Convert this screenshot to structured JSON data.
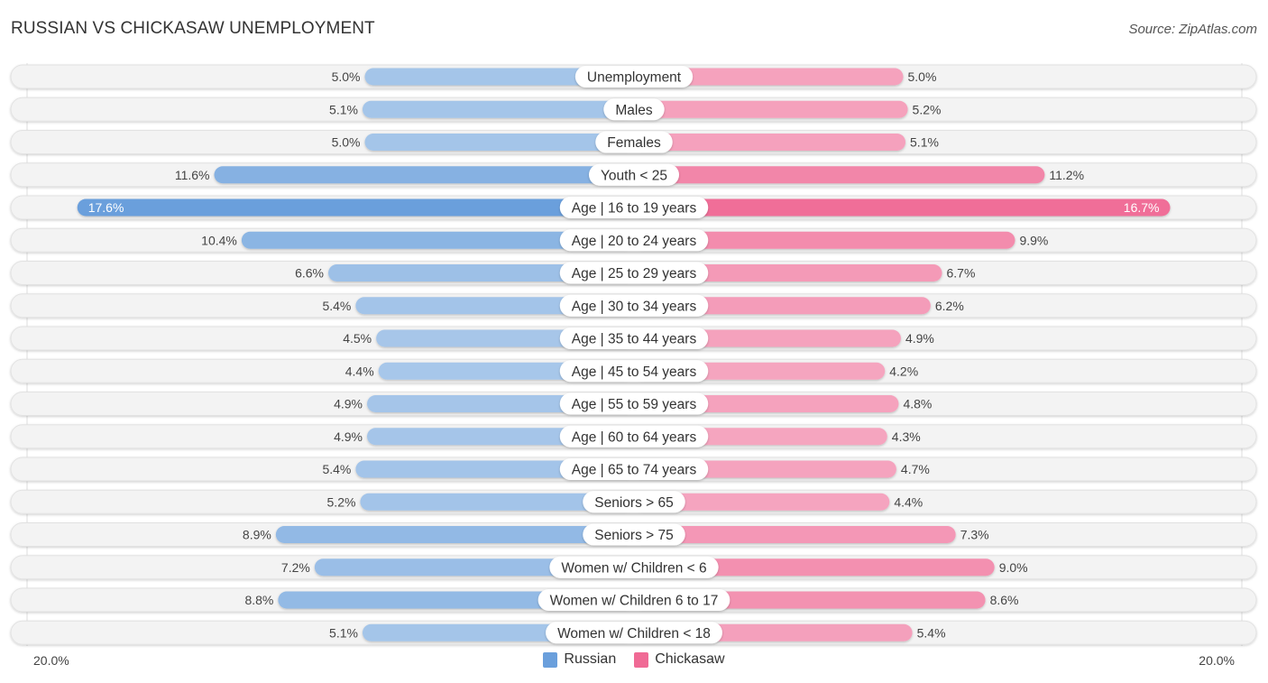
{
  "header": {
    "title": "RUSSIAN VS CHICKASAW UNEMPLOYMENT",
    "source": "Source: ZipAtlas.com"
  },
  "colors": {
    "russian_strong": "#6a9fdc",
    "russian_light": "#a9c8ea",
    "chickasaw_strong": "#f06a95",
    "chickasaw_light": "#f5a6c0",
    "row_bg": "#f3f3f3"
  },
  "chart_data": {
    "type": "bar",
    "orientation": "horizontal-diverging",
    "title": "RUSSIAN VS CHICKASAW UNEMPLOYMENT",
    "xlabel": "",
    "ylabel": "",
    "xlim": [
      0,
      20
    ],
    "axis_left_label": "20.0%",
    "axis_right_label": "20.0%",
    "legend_position": "bottom-center",
    "categories": [
      "Unemployment",
      "Males",
      "Females",
      "Youth < 25",
      "Age | 16 to 19 years",
      "Age | 20 to 24 years",
      "Age | 25 to 29 years",
      "Age | 30 to 34 years",
      "Age | 35 to 44 years",
      "Age | 45 to 54 years",
      "Age | 55 to 59 years",
      "Age | 60 to 64 years",
      "Age | 65 to 74 years",
      "Seniors > 65",
      "Seniors > 75",
      "Women w/ Children < 6",
      "Women w/ Children 6 to 17",
      "Women w/ Children < 18"
    ],
    "series": [
      {
        "name": "Russian",
        "side": "left",
        "values": [
          5.0,
          5.1,
          5.0,
          11.6,
          17.6,
          10.4,
          6.6,
          5.4,
          4.5,
          4.4,
          4.9,
          4.9,
          5.4,
          5.2,
          8.9,
          7.2,
          8.8,
          5.1
        ],
        "labels": [
          "5.0%",
          "5.1%",
          "5.0%",
          "11.6%",
          "17.6%",
          "10.4%",
          "6.6%",
          "5.4%",
          "4.5%",
          "4.4%",
          "4.9%",
          "4.9%",
          "5.4%",
          "5.2%",
          "8.9%",
          "7.2%",
          "8.8%",
          "5.1%"
        ]
      },
      {
        "name": "Chickasaw",
        "side": "right",
        "values": [
          5.0,
          5.2,
          5.1,
          11.2,
          16.7,
          9.9,
          6.7,
          6.2,
          4.9,
          4.2,
          4.8,
          4.3,
          4.7,
          4.4,
          7.3,
          9.0,
          8.6,
          5.4
        ],
        "labels": [
          "5.0%",
          "5.2%",
          "5.1%",
          "11.2%",
          "16.7%",
          "9.9%",
          "6.7%",
          "6.2%",
          "4.9%",
          "4.2%",
          "4.8%",
          "4.3%",
          "4.7%",
          "4.4%",
          "7.3%",
          "9.0%",
          "8.6%",
          "5.4%"
        ]
      }
    ]
  },
  "legend": {
    "items": [
      {
        "label": "Russian"
      },
      {
        "label": "Chickasaw"
      }
    ]
  }
}
